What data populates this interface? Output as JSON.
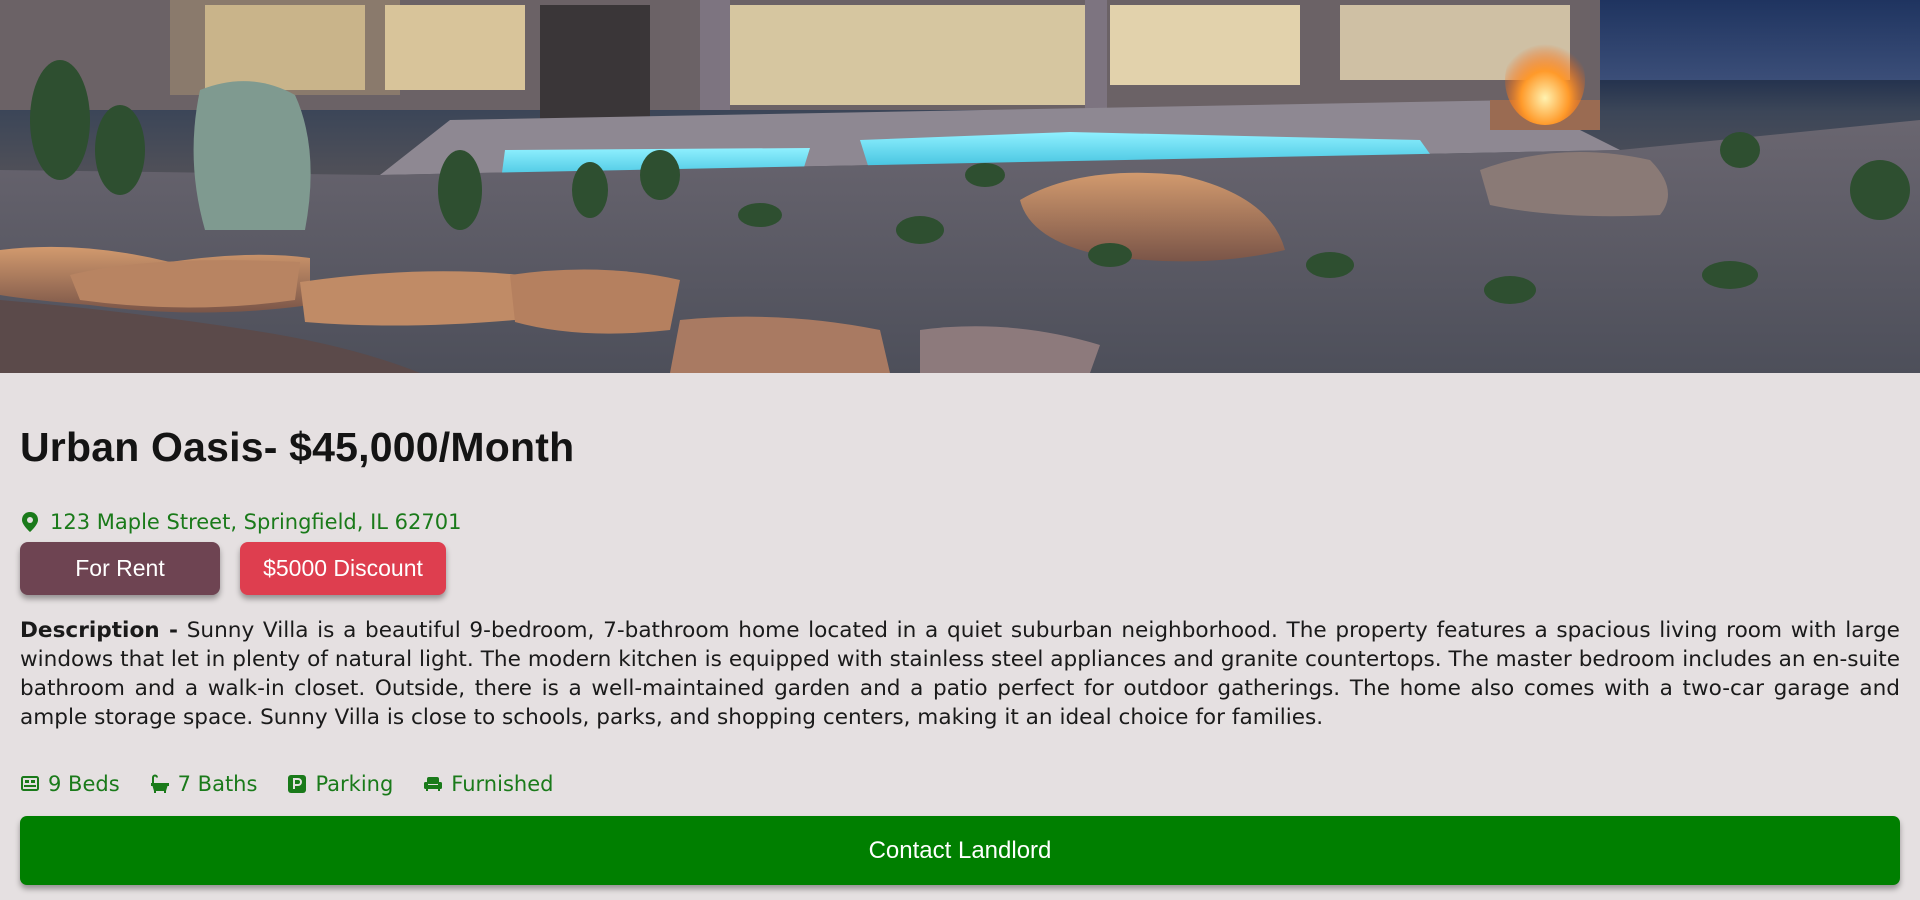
{
  "listing": {
    "title": "Urban Oasis- $45,000/Month",
    "address": "123 Maple Street, Springfield, IL 62701",
    "badges": {
      "status": "For Rent",
      "discount": "$5000 Discount"
    },
    "description_label": "Description -",
    "description": "Sunny Villa is a beautiful 9-bedroom, 7-bathroom home located in a quiet suburban neighborhood. The property features a spacious living room with large windows that let in plenty of natural light. The modern kitchen is equipped with stainless steel appliances and granite countertops. The master bedroom includes an en-suite bathroom and a walk-in closet. Outside, there is a well-maintained garden and a patio perfect for outdoor gatherings. The home also comes with a two-car garage and ample storage space. Sunny Villa is close to schools, parks, and shopping centers, making it an ideal choice for families.",
    "features": [
      {
        "icon": "bed-icon",
        "label": "9 Beds"
      },
      {
        "icon": "bath-icon",
        "label": "7 Baths"
      },
      {
        "icon": "parking-icon",
        "label": "Parking"
      },
      {
        "icon": "sofa-icon",
        "label": "Furnished"
      }
    ],
    "contact_label": "Contact Landlord"
  },
  "colors": {
    "accent_green": "#007f00",
    "text_green": "#1a7a1a",
    "rent_badge": "#6e4452",
    "discount_badge": "#de3e4f",
    "page_background": "#e5e0e1"
  }
}
